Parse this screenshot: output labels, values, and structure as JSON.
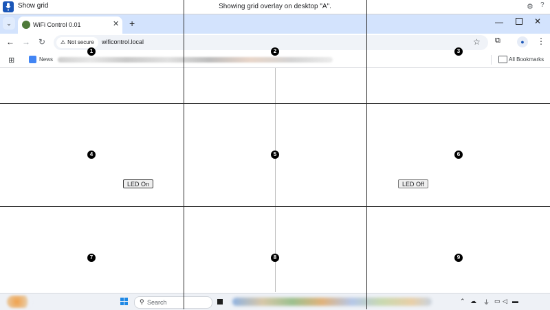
{
  "voice_access": {
    "label": "Show grid",
    "status": "Showing grid overlay on desktop \"A\".",
    "settings_icon": "gear-icon",
    "help_label": "?"
  },
  "tabs": [
    {
      "title": "WiFi Control 0.01",
      "active": true
    }
  ],
  "address_bar": {
    "security_label": "Not secure",
    "url": "wificontrol.local"
  },
  "bookmarks": {
    "items": [
      {
        "label": "News"
      }
    ],
    "all_label": "All Bookmarks"
  },
  "page": {
    "led_on_label": "LED On",
    "led_off_label": "LED Off"
  },
  "grid": {
    "labels": [
      "1",
      "2",
      "3",
      "4",
      "5",
      "6",
      "7",
      "8",
      "9"
    ]
  },
  "taskbar": {
    "search_label": "Search"
  },
  "colors": {
    "voice_access_accent": "#1a56b8",
    "tab_strip": "#d3e3fd",
    "grid_line": "#2b2b2b"
  }
}
